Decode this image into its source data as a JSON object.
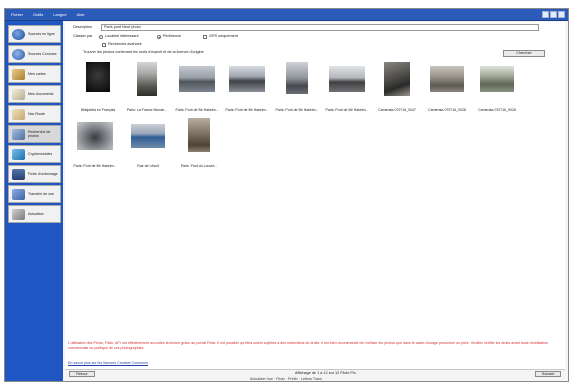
{
  "menu": [
    "Fichier",
    "Outils",
    "Langue",
    "Aide"
  ],
  "sidebar": {
    "items": [
      {
        "label": "Sources en ligne",
        "icon": "globe-icon",
        "color": "#2f5fb3"
      },
      {
        "label": "Sources Connues",
        "icon": "globe-search-icon",
        "color": "#4472c4"
      },
      {
        "label": "Mes cartes",
        "icon": "map-icon",
        "color": "#c9a24a"
      },
      {
        "label": "Mes documents",
        "icon": "documents-icon",
        "color": "#c9c2a8"
      },
      {
        "label": "Nav Route",
        "icon": "route-map-icon",
        "color": "#d8c7a0"
      },
      {
        "label": "Recherche de photos",
        "icon": "photo-search-icon",
        "color": "#6a8fbf"
      },
      {
        "label": "Cryptomodules",
        "icon": "puzzle-icon",
        "color": "#3a8ac6"
      },
      {
        "label": "Fiche d'ordonnage",
        "icon": "list-icon",
        "color": "#3c5d8f"
      },
      {
        "label": "Transfert de vue",
        "icon": "transfer-icon",
        "color": "#5b7fbf"
      },
      {
        "label": "Actualiser",
        "icon": "refresh-icon",
        "color": "#808080"
      }
    ]
  },
  "search": {
    "description_label": "Description",
    "description_value": "Paris pont Neuf photo",
    "order_label": "Classer par",
    "option_ordered": "Localisé intéressant",
    "option_relevance": "Pertinence",
    "option_gps": "GPS uniquement",
    "option_advanced": "Recherche avancée",
    "scope_text": "Trouver les photos contenant les mots d'exploit et de la licence d'origine",
    "search_button": "Chercher"
  },
  "photos": [
    {
      "caption": "Wikipédia en Français",
      "palette": "#141414"
    },
    {
      "caption": "Paris: La France Monde...",
      "palette": "#6c6a64"
    },
    {
      "caption": "Paris: Pont de Bir Hakeim...",
      "palette": "#8a8d92"
    },
    {
      "caption": "Paris: Pont de Bir Hakeim...",
      "palette": "#7d8189"
    },
    {
      "caption": "Paris: Pont de Bir Hakeim...",
      "palette": "#838991"
    },
    {
      "caption": "Paris: Pont de Bir Hakeim...",
      "palette": "#6f7277"
    },
    {
      "caption": "Camerata 070716_0047",
      "palette": "#5b5a57"
    },
    {
      "caption": "Camerata 070716_0028",
      "palette": "#7e7a73"
    },
    {
      "caption": "Camerata 070716_0026",
      "palette": "#6c7166"
    },
    {
      "caption": "Paris: Pont de Bir Hakeim...",
      "palette": "#75787a"
    },
    {
      "caption": "Rue de Lésult",
      "palette": "#5e748c"
    },
    {
      "caption": "Paris: Pont du Louvre...",
      "palette": "#6e6255"
    }
  ],
  "notice": "L'utilisation des Photo, Flickr, API ont effectivement accordés la lecture grâce au portail Flickr. Il est possible qu'elles soient sujettes à des restrictions de droits. Il est bien recommandé de n'utiliser les photos que dans le cadre d'usage personnel ou privé. Veuillez vérifier les droits avant toute réutilisation commerciale ou publique de ces photographies.",
  "license_link": "En savoir plus sur les licences Creative Commons",
  "status": {
    "back_button": "Retour",
    "count_text": "Affichage de 1 à 12 sur 12 Flickr Pix",
    "next_button": "Suivant"
  },
  "footer": "Actualiser Vue · Flickr · Préfér · Lettres Trans"
}
